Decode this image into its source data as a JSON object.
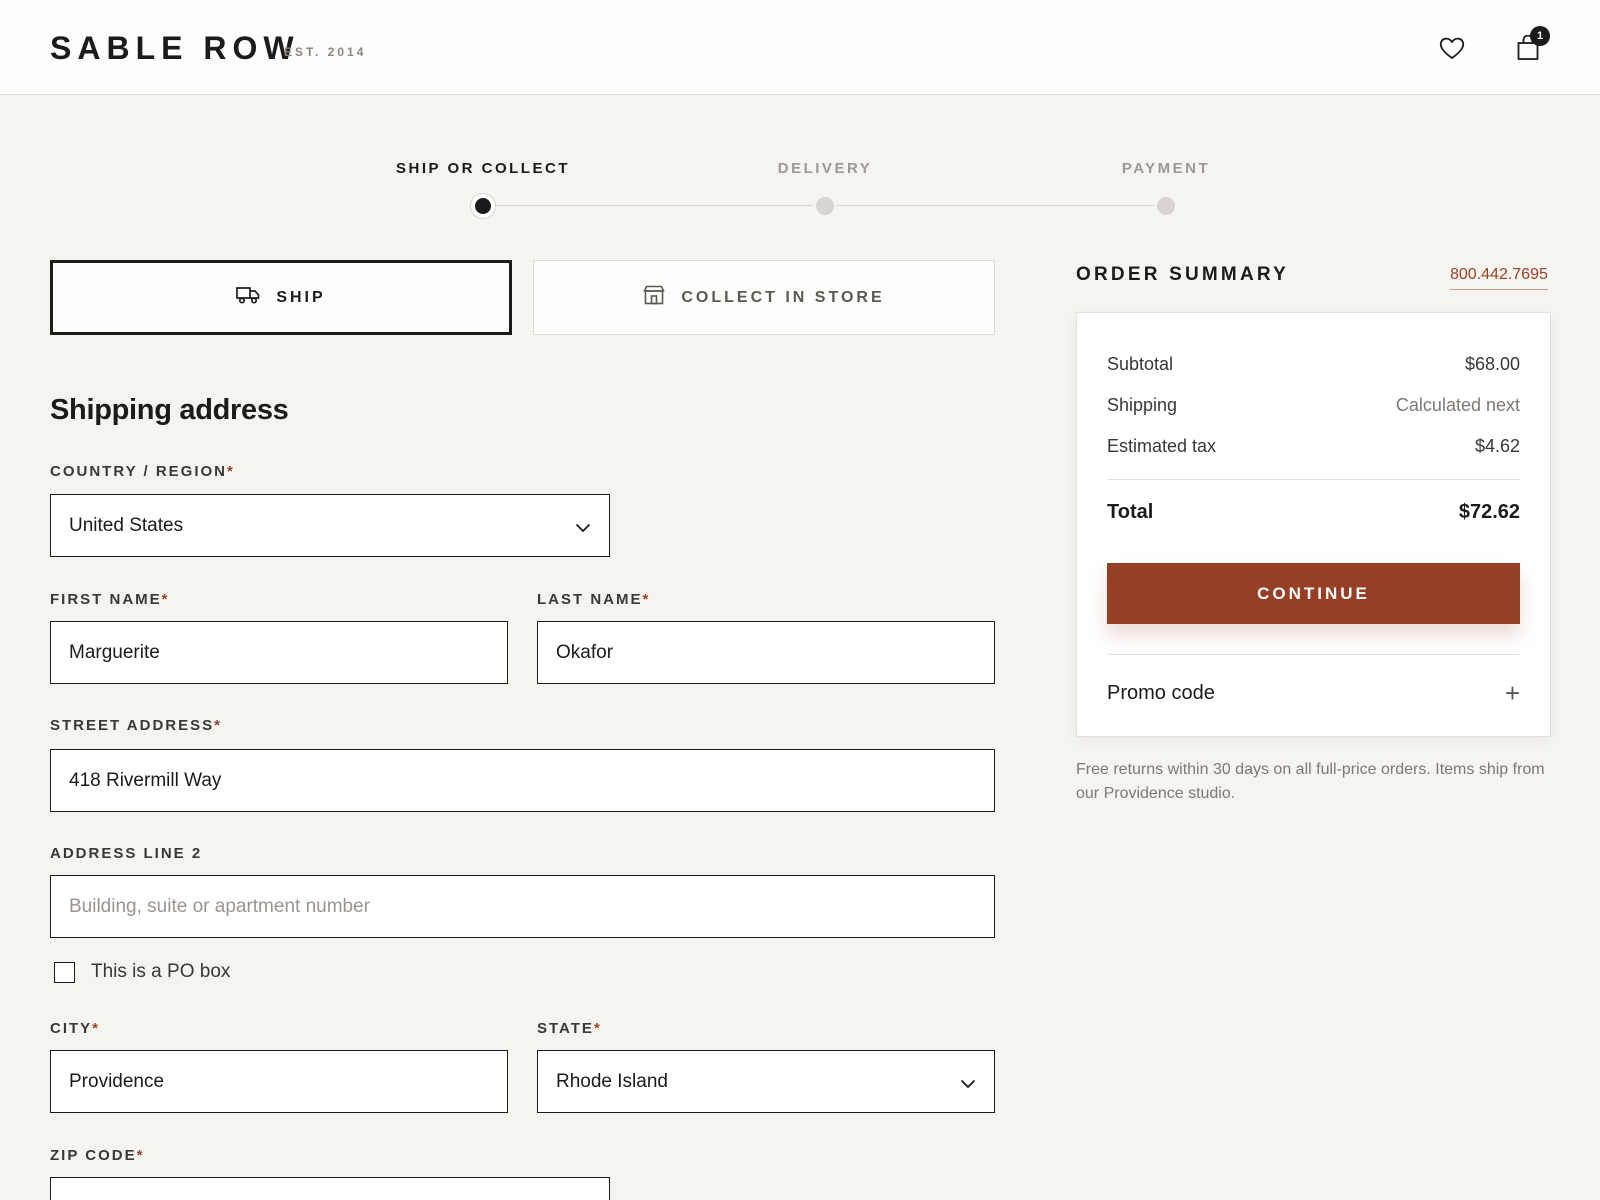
{
  "header": {
    "brand": "SABLE ROW",
    "est": "EST. 2014",
    "cart_count": "1"
  },
  "steps": [
    {
      "label": "SHIP OR COLLECT",
      "state": "active"
    },
    {
      "label": "DELIVERY",
      "state": "inactive"
    },
    {
      "label": "PAYMENT",
      "state": "inactive"
    }
  ],
  "method": {
    "ship_label": "SHIP",
    "collect_label": "COLLECT IN STORE",
    "selected": "ship"
  },
  "form": {
    "title": "Shipping address",
    "country_label": "COUNTRY / REGION",
    "country_value": "United States",
    "first_name_label": "FIRST NAME",
    "first_name_value": "Marguerite",
    "last_name_label": "LAST NAME",
    "last_name_value": "Okafor",
    "street_label": "STREET ADDRESS",
    "street_value": "418 Rivermill Way",
    "line2_label": "ADDRESS LINE 2",
    "line2_placeholder": "Building, suite or apartment number",
    "po_box_label": "This is a PO box",
    "city_label": "CITY",
    "city_value": "Providence",
    "state_label": "STATE",
    "state_value": "Rhode Island",
    "zip_label": "ZIP CODE",
    "required_mark": "*"
  },
  "summary": {
    "title": "ORDER SUMMARY",
    "phone": "800.442.7695",
    "subtotal_label": "Subtotal",
    "subtotal_value": "$68.00",
    "shipping_label": "Shipping",
    "shipping_value": "Calculated next",
    "tax_label": "Estimated tax",
    "tax_value": "$4.62",
    "total_label": "Total",
    "total_value": "$72.62",
    "continue_label": "CONTINUE",
    "promo_label": "Promo code",
    "promo_toggle": "+",
    "note": "Free returns within 30 days on all full-price orders. Items ship from our Providence studio."
  },
  "colors": {
    "accent": "#963f25",
    "text": "#1c1b1a",
    "background": "#f6f4f1"
  }
}
